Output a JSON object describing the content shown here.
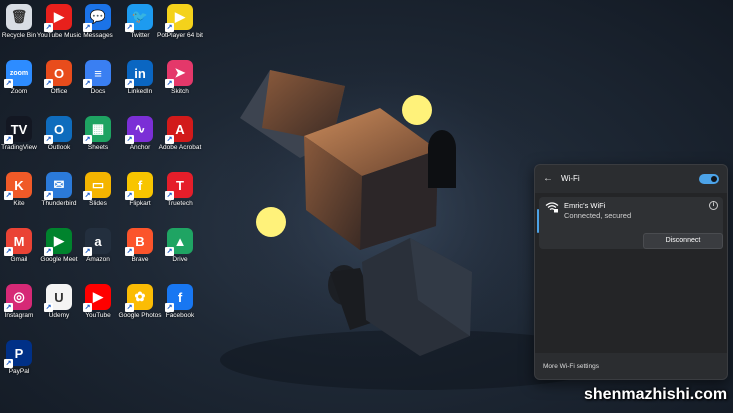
{
  "desktop": {
    "icons": [
      {
        "label": "Recycle Bin",
        "glyph": "🗑",
        "color": "#d8dde4",
        "icon": "recycle-bin-icon"
      },
      {
        "label": "YouTube Music",
        "glyph": "▶",
        "color": "#e8201c",
        "icon": "youtube-music-icon"
      },
      {
        "label": "Messages",
        "glyph": "💬",
        "color": "#1b73e8",
        "icon": "messages-icon"
      },
      {
        "label": "Twitter",
        "glyph": "🐦",
        "color": "#1d9bf0",
        "icon": "twitter-icon"
      },
      {
        "label": "PotPlayer 64 bit",
        "glyph": "▶",
        "color": "#f4d21b",
        "icon": "potplayer-icon"
      },
      {
        "label": "Zoom",
        "glyph": "zoom",
        "color": "#2d8cff",
        "icon": "zoom-icon"
      },
      {
        "label": "Office",
        "glyph": "O",
        "color": "#e84c1c",
        "icon": "office-icon"
      },
      {
        "label": "Docs",
        "glyph": "≡",
        "color": "#3a7ff2",
        "icon": "docs-icon"
      },
      {
        "label": "LinkedIn",
        "glyph": "in",
        "color": "#0a66c2",
        "icon": "linkedin-icon"
      },
      {
        "label": "Skitch",
        "glyph": "➤",
        "color": "#e4386a",
        "icon": "skitch-icon"
      },
      {
        "label": "TradingView",
        "glyph": "TV",
        "color": "#131722",
        "icon": "tradingview-icon"
      },
      {
        "label": "Outlook",
        "glyph": "O",
        "color": "#0f6cbd",
        "icon": "outlook-icon"
      },
      {
        "label": "Sheets",
        "glyph": "▦",
        "color": "#1ea362",
        "icon": "sheets-icon"
      },
      {
        "label": "Anchor",
        "glyph": "∿",
        "color": "#7b2fd6",
        "icon": "anchor-icon"
      },
      {
        "label": "Adobe Acrobat",
        "glyph": "A",
        "color": "#d21a1a",
        "icon": "adobe-acrobat-icon"
      },
      {
        "label": "Kite",
        "glyph": "K",
        "color": "#f05a28",
        "icon": "kite-icon"
      },
      {
        "label": "Thunderbird",
        "glyph": "✉",
        "color": "#2b7ad9",
        "icon": "thunderbird-icon"
      },
      {
        "label": "Slides",
        "glyph": "▭",
        "color": "#f4b400",
        "icon": "slides-icon"
      },
      {
        "label": "Flipkart",
        "glyph": "f",
        "color": "#f8c500",
        "icon": "flipkart-icon"
      },
      {
        "label": "Truetech",
        "glyph": "T",
        "color": "#e51e2a",
        "icon": "truetech-icon"
      },
      {
        "label": "Gmail",
        "glyph": "M",
        "color": "#ea4335",
        "icon": "gmail-icon"
      },
      {
        "label": "Google Meet",
        "glyph": "▶",
        "color": "#00832d",
        "icon": "google-meet-icon"
      },
      {
        "label": "Amazon",
        "glyph": "a",
        "color": "#232f3e",
        "icon": "amazon-icon"
      },
      {
        "label": "Brave",
        "glyph": "B",
        "color": "#fb542b",
        "icon": "brave-icon"
      },
      {
        "label": "Drive",
        "glyph": "▲",
        "color": "#1fa463",
        "icon": "drive-icon"
      },
      {
        "label": "Instagram",
        "glyph": "◎",
        "color": "#d62976",
        "icon": "instagram-icon"
      },
      {
        "label": "Udemy",
        "glyph": "U",
        "color": "#f4f4f4",
        "icon": "udemy-icon"
      },
      {
        "label": "YouTube",
        "glyph": "▶",
        "color": "#ff0000",
        "icon": "youtube-icon"
      },
      {
        "label": "Google Photos",
        "glyph": "✿",
        "color": "#fbbc04",
        "icon": "google-photos-icon"
      },
      {
        "label": "Facebook",
        "glyph": "f",
        "color": "#1877f2",
        "icon": "facebook-icon"
      },
      {
        "label": "PayPal",
        "glyph": "P",
        "color": "#003087",
        "icon": "paypal-icon"
      }
    ]
  },
  "wifi_flyout": {
    "title": "Wi-Fi",
    "toggle_on": true,
    "network": {
      "name": "Emric's WiFi",
      "status": "Connected, secured"
    },
    "disconnect_label": "Disconnect",
    "more_settings_label": "More Wi-Fi settings"
  },
  "watermark": "shenmazhishi.com",
  "colors": {
    "accent": "#4ca3e8",
    "panel": "#2b2d30"
  }
}
